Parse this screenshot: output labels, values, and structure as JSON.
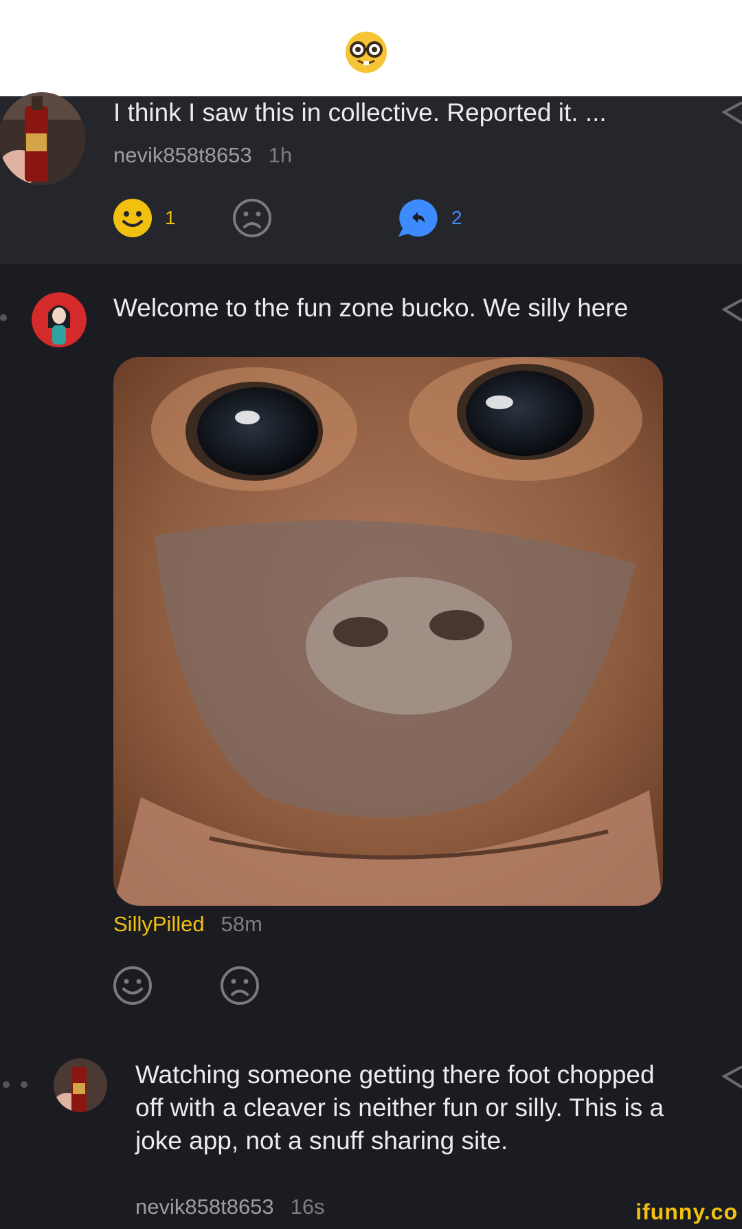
{
  "comments": [
    {
      "text": "I think I saw this in collective. Reported it. ...",
      "username": "nevik858t8653",
      "time": "1h",
      "smile_count": "1",
      "reply_count": "2"
    },
    {
      "text": "Welcome to the fun zone bucko. We silly here",
      "username": "SillyPilled",
      "time": "58m"
    },
    {
      "text": "Watching someone getting there foot chopped off with a cleaver is neither fun or silly. This is a joke app, not a snuff sharing site.",
      "username": "nevik858t8653",
      "time": "16s"
    }
  ],
  "watermark": "ifunny.co",
  "colors": {
    "gold": "#f2c10f",
    "blue": "#3d8bff",
    "bg_dark": "#1b1c21",
    "bg_comment": "#25262b"
  },
  "icons": [
    "nerd-face-emoji",
    "smile-icon",
    "frown-icon",
    "reply-icon",
    "share-icon"
  ]
}
